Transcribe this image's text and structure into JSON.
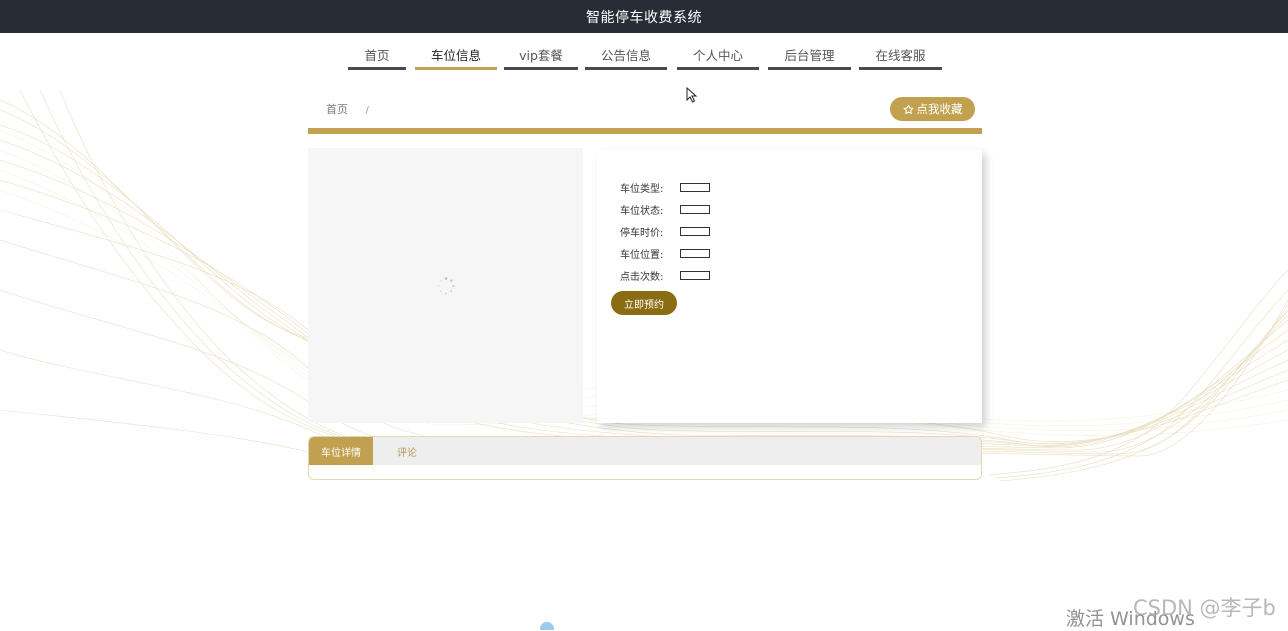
{
  "app": {
    "title": "智能停车收费系统"
  },
  "nav": {
    "items": [
      {
        "label": "首页"
      },
      {
        "label": "车位信息",
        "active": true
      },
      {
        "label": "vip套餐"
      },
      {
        "label": "公告信息"
      },
      {
        "label": "个人中心"
      },
      {
        "label": "后台管理"
      },
      {
        "label": "在线客服"
      }
    ]
  },
  "breadcrumb": {
    "home": "首页",
    "separator": "/"
  },
  "favorite": {
    "icon": "star-outline-icon",
    "label": "点我收藏"
  },
  "details": {
    "rows": [
      {
        "label": "车位类型:",
        "value": ""
      },
      {
        "label": "车位状态:",
        "value": ""
      },
      {
        "label": "停车时价:",
        "value": ""
      },
      {
        "label": "车位位置:",
        "value": ""
      },
      {
        "label": "点击次数:",
        "value": ""
      }
    ],
    "reserve_label": "立即预约"
  },
  "tabs": [
    {
      "label": "车位详情",
      "active": true
    },
    {
      "label": "评论",
      "active": false
    }
  ],
  "watermarks": {
    "windows": "激活 Windows",
    "csdn": "CSDN @李子b"
  },
  "colors": {
    "accent": "#c1a14f",
    "dark_bar": "#282c35",
    "reserve_button": "#8a6d12",
    "nav_underline": "#4a4a4a"
  }
}
